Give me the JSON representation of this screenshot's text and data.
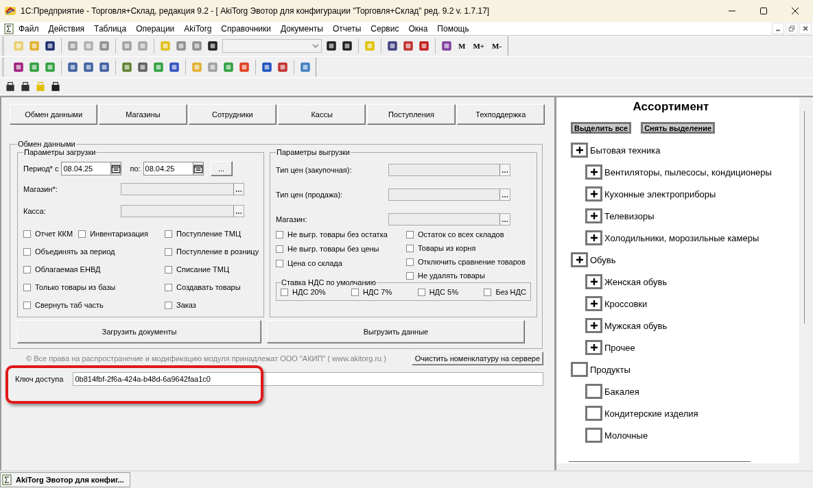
{
  "window": {
    "title": "1С:Предприятие - Торговля+Склад, редакция 9.2 - [ AkiTorg Эвотор для конфигурации \"Торговля+Склад\" ред. 9.2 v. 1.7.17]"
  },
  "menu": [
    "Файл",
    "Действия",
    "Таблица",
    "Операции",
    "AkiTorg",
    "Справочники",
    "Документы",
    "Отчеты",
    "Сервис",
    "Окна",
    "Помощь"
  ],
  "toolbar": {
    "memory_buttons": [
      "M",
      "M+",
      "M-"
    ]
  },
  "nav_buttons": [
    "Обмен данными",
    "Магазины",
    "Сотрудники",
    "Кассы",
    "Поступления",
    "Техподдержка"
  ],
  "exchange": {
    "title": "Обмен данными",
    "import": {
      "title": "Параметры загрузки",
      "period_label": "Период* с",
      "date_from": "08.04.25",
      "to_label": "по:",
      "date_to": "08.04.25",
      "more_button": "...",
      "fields": [
        {
          "label": "Магазин*:"
        },
        {
          "label": "Касса:"
        }
      ],
      "checkbox_rows": [
        {
          "left": [
            {
              "label": "Отчет ККМ",
              "checked": false
            },
            {
              "label": "Инвентаризация",
              "checked": false
            }
          ],
          "right": {
            "label": "Поступление ТМЦ",
            "checked": false
          }
        },
        {
          "left": [
            {
              "label": "Объединять за период",
              "checked": false
            }
          ],
          "right": {
            "label": "Поступление в розницу",
            "checked": false
          }
        },
        {
          "left": [
            {
              "label": "Облагаемая ЕНВД",
              "checked": false
            }
          ],
          "right": {
            "label": "Списание ТМЦ",
            "checked": false
          }
        },
        {
          "left": [
            {
              "label": "Только товары из базы",
              "checked": false
            }
          ],
          "right": {
            "label": "Создавать товары",
            "checked": false
          }
        },
        {
          "left": [
            {
              "label": "Свернуть таб часть",
              "checked": false
            }
          ],
          "right": {
            "label": "Заказ",
            "checked": false
          }
        }
      ],
      "action": "Загрузить документы"
    },
    "export": {
      "title": "Параметры выгрузки",
      "fields": [
        {
          "label": "Тип цен (закупочная):"
        },
        {
          "label": "Тип цен (продажа):"
        },
        {
          "label": "Магазин:"
        }
      ],
      "left_checkboxes": [
        {
          "label": "Не выгр. товары без остатка",
          "checked": false
        },
        {
          "label": "Не выгр. товары без цены",
          "checked": false
        },
        {
          "label": "Цена со склада",
          "checked": false
        }
      ],
      "right_checkboxes": [
        {
          "label": "Остаток со всех складов",
          "checked": false
        },
        {
          "label": "Товары из корня",
          "checked": false
        },
        {
          "label": "Отключить сравнение товаров",
          "checked": false
        },
        {
          "label": "Не удалять товары",
          "checked": false
        }
      ],
      "vat": {
        "title": "Ставка НДС по умолчанию",
        "options": [
          {
            "label": "НДС 20%",
            "checked": false
          },
          {
            "label": "НДС 7%",
            "checked": false
          },
          {
            "label": "НДС 5%",
            "checked": false
          },
          {
            "label": "Без НДС",
            "checked": false
          }
        ]
      },
      "action": "Выгрузить данные"
    }
  },
  "copyright": "© Все права на распространение и модификацию модуля принадлежат ООО \"АКИП\" ( www.akitorg.ru )",
  "clear_button": "Очистить номенклатуру на сервере",
  "access_key": {
    "label": "Ключ доступа",
    "value": "0b814fbf-2f6a-424a-b48d-6a9642faa1c0"
  },
  "assortment": {
    "title": "Ассортимент",
    "select_all": "Выделить все",
    "deselect_all": "Снять выделение",
    "items": [
      {
        "label": "Бытовая техника",
        "checked": true,
        "children": [
          {
            "label": "Вентиляторы, пылесосы, кондиционеры",
            "checked": true
          },
          {
            "label": "Кухонные электроприборы",
            "checked": true
          },
          {
            "label": "Телевизоры",
            "checked": true
          },
          {
            "label": "Холодильники, морозильные камеры",
            "checked": true
          }
        ]
      },
      {
        "label": "Обувь",
        "checked": true,
        "children": [
          {
            "label": "Женская обувь",
            "checked": true
          },
          {
            "label": "Кроссовки",
            "checked": true
          },
          {
            "label": "Мужская обувь",
            "checked": true
          },
          {
            "label": "Прочее",
            "checked": true
          }
        ]
      },
      {
        "label": "Продукты",
        "checked": false,
        "children": [
          {
            "label": "Бакалея",
            "checked": false
          },
          {
            "label": "Кондитерские изделия",
            "checked": false
          },
          {
            "label": "Молочные",
            "checked": false
          }
        ]
      }
    ]
  },
  "taskbar": {
    "window_button": "AkiTorg Эвотор для конфиг..."
  }
}
